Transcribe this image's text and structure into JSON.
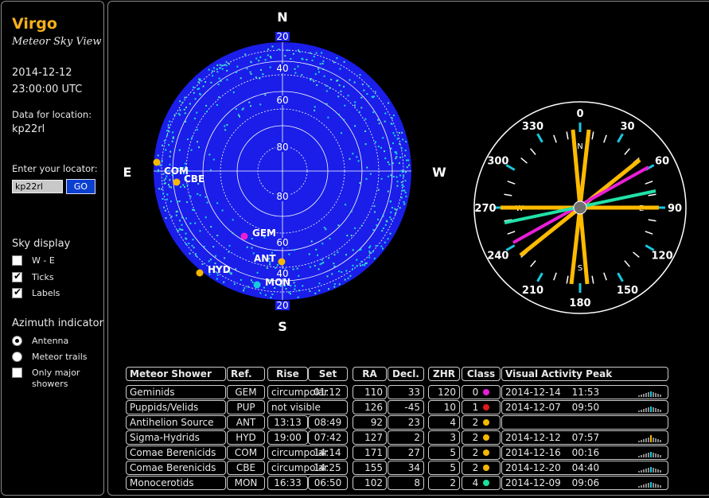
{
  "sidebar": {
    "title": "Virgo",
    "subtitle": "Meteor Sky View",
    "date": "2014-12-12",
    "time": "23:00:00 UTC",
    "location_label": "Data for location:",
    "location": "kp22rl",
    "locator_label": "Enter your locator:",
    "locator_value": "kp22rl",
    "go_label": "GO",
    "sky_display_label": "Sky display",
    "sky_options": [
      {
        "label": "W - E",
        "checked": false
      },
      {
        "label": "Ticks",
        "checked": true
      },
      {
        "label": "Labels",
        "checked": true
      }
    ],
    "azimuth_label": "Azimuth indicator",
    "azimuth_options": [
      {
        "label": "Antenna",
        "selected": true
      },
      {
        "label": "Meteor trails",
        "selected": false
      }
    ],
    "major_only_label": "Only major showers",
    "major_only_checked": false
  },
  "sky": {
    "compass": {
      "N": "N",
      "S": "S",
      "E": "E",
      "W": "W"
    },
    "alt_labels_top": [
      "20",
      "40",
      "60",
      "80"
    ],
    "alt_labels_bottom": [
      "80",
      "60",
      "40",
      "20"
    ],
    "showers": [
      {
        "code": "COM",
        "color": "#f5b800"
      },
      {
        "code": "CBE",
        "color": "#f5b800"
      },
      {
        "code": "GEM",
        "color": "#e91ed6"
      },
      {
        "code": "ANT",
        "color": "#f5b800"
      },
      {
        "code": "HYD",
        "color": "#f5b800"
      },
      {
        "code": "MON",
        "color": "#19c8e0"
      }
    ]
  },
  "azimuth": {
    "labels": [
      "0",
      "30",
      "60",
      "90",
      "120",
      "150",
      "180",
      "210",
      "240",
      "270",
      "300",
      "330"
    ],
    "inner_letters": {
      "N": "N",
      "E": "E",
      "S": "S",
      "W": "W"
    },
    "antenna_colors": {
      "orange": "#ffbb00",
      "magenta": "#e91ed6",
      "green": "#22e0a8"
    }
  },
  "table": {
    "headers": {
      "shower": "Meteor Shower",
      "ref": "Ref.",
      "rise": "Rise",
      "set": "Set",
      "ra": "RA",
      "decl": "Decl.",
      "zhr": "ZHR",
      "class": "Class",
      "peak": "Visual Activity Peak"
    },
    "rows": [
      {
        "name": "Geminids",
        "ref": "GEM",
        "riseset": "circumpolar",
        "set": "01:12",
        "ra": "110",
        "decl": "33",
        "zhr": "120",
        "cls": "0",
        "dot": "#e91ed6",
        "peak_date": "2014-12-14",
        "peak_time": "11:53",
        "bars": [
          2,
          3,
          4,
          5,
          6,
          7,
          6,
          5,
          4,
          3
        ]
      },
      {
        "name": "Puppids/Velids",
        "ref": "PUP",
        "rise": "not visible",
        "set": "",
        "ra": "126",
        "decl": "-45",
        "zhr": "10",
        "cls": "1",
        "dot": "#e01a1a",
        "peak_date": "2014-12-07",
        "peak_time": "09:50",
        "bars": [
          2,
          3,
          4,
          5,
          6,
          7,
          6,
          5,
          4,
          3
        ]
      },
      {
        "name": "Antihelion Source",
        "ref": "ANT",
        "rise": "13:13",
        "set": "08:49",
        "ra": "92",
        "decl": "23",
        "zhr": "4",
        "cls": "2",
        "dot": "#f5b800",
        "peak_date": "",
        "peak_time": "",
        "bars": []
      },
      {
        "name": "Sigma-Hydrids",
        "ref": "HYD",
        "rise": "19:00",
        "set": "07:42",
        "ra": "127",
        "decl": "2",
        "zhr": "3",
        "cls": "2",
        "dot": "#f5b800",
        "peak_date": "2014-12-12",
        "peak_time": "07:57",
        "bars": [
          2,
          3,
          4,
          5,
          6,
          9,
          6,
          5,
          4,
          3
        ]
      },
      {
        "name": "Comae Berenicids",
        "ref": "COM",
        "riseset": "circumpolar",
        "set": "14:14",
        "ra": "171",
        "decl": "27",
        "zhr": "5",
        "cls": "2",
        "dot": "#f5b800",
        "peak_date": "2014-12-16",
        "peak_time": "00:16",
        "bars": [
          2,
          3,
          4,
          5,
          6,
          7,
          6,
          5,
          4,
          3
        ]
      },
      {
        "name": "Comae Berenicids",
        "ref": "CBE",
        "riseset": "circumpolar",
        "set": "14:25",
        "ra": "155",
        "decl": "34",
        "zhr": "5",
        "cls": "2",
        "dot": "#f5b800",
        "peak_date": "2014-12-20",
        "peak_time": "04:40",
        "bars": [
          2,
          3,
          4,
          5,
          6,
          7,
          6,
          5,
          4,
          3
        ]
      },
      {
        "name": "Monocerotids",
        "ref": "MON",
        "rise": "16:33",
        "set": "06:50",
        "ra": "102",
        "decl": "8",
        "zhr": "2",
        "cls": "4",
        "dot": "#19e0a0",
        "peak_date": "2014-12-09",
        "peak_time": "09:06",
        "bars": [
          2,
          3,
          4,
          5,
          6,
          7,
          6,
          5,
          4,
          3
        ]
      }
    ]
  }
}
